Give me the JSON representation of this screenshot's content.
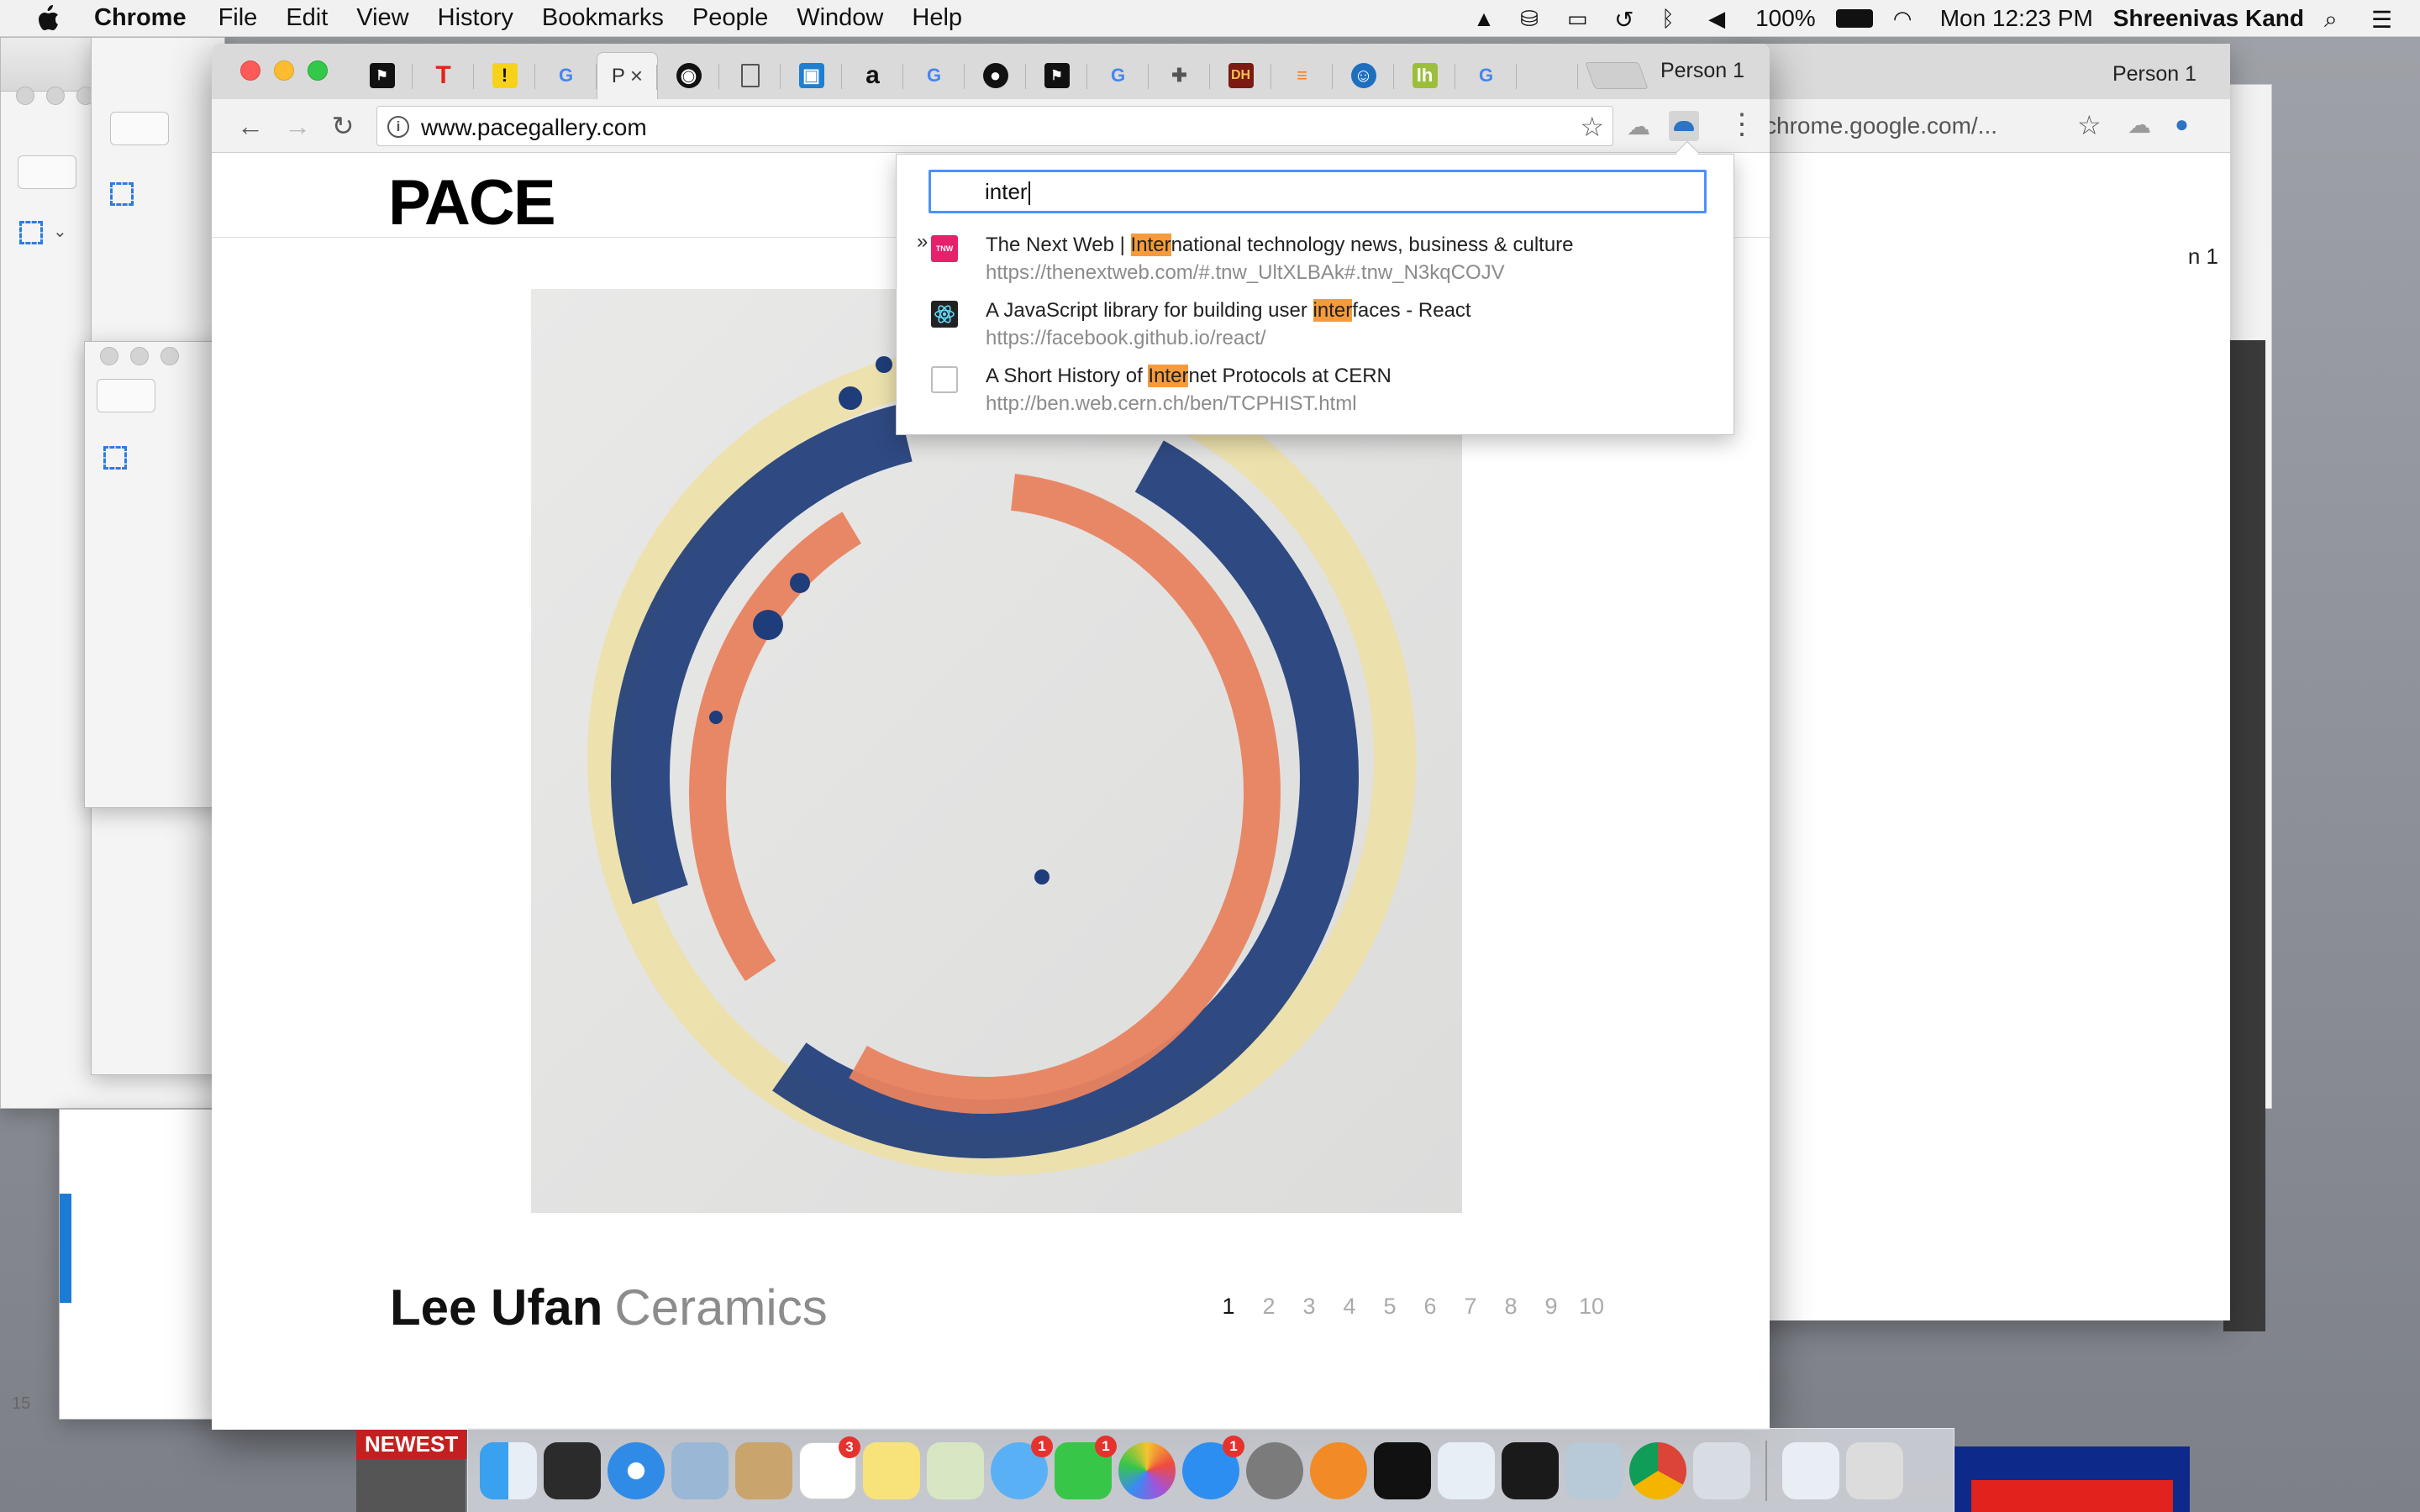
{
  "menubar": {
    "app_name": "Chrome",
    "items": [
      "File",
      "Edit",
      "View",
      "History",
      "Bookmarks",
      "People",
      "Window",
      "Help"
    ],
    "battery": "100%",
    "clock": "Mon 12:23 PM",
    "user": "Shreenivas Kand"
  },
  "browser": {
    "active_tab_title": "P",
    "profile": "Person 1",
    "url": "www.pacegallery.com",
    "tab_icons": [
      "flag-icon",
      "t-icon",
      "yellow-icon",
      "google-icon",
      "pace-tab",
      "circle-icon",
      "doc-icon",
      "photo-icon",
      "amazon-icon",
      "google-icon",
      "github-icon",
      "flag-icon",
      "google-icon",
      "puzzle-icon",
      "dh-icon",
      "stack-icon",
      "pbs-icon",
      "lh-icon",
      "google-icon",
      "apple-icon"
    ]
  },
  "page": {
    "logo": "PACE",
    "artist": "Lee Ufan",
    "exhibition": "Ceramics",
    "pages": [
      "1",
      "2",
      "3",
      "4",
      "5",
      "6",
      "7",
      "8",
      "9",
      "10"
    ],
    "current_page": "1"
  },
  "popup": {
    "query": "inter",
    "results": [
      {
        "marker": "»",
        "title_pre": "The Next Web | ",
        "title_hl": "Inter",
        "title_post": "national technology news, business & culture",
        "url": "https://thenextweb.com/#.tnw_UltXLBAk#.tnw_N3kqCOJV",
        "fav_text": "TNW"
      },
      {
        "marker": "",
        "title_pre": "A JavaScript library for building user ",
        "title_hl": "inter",
        "title_post": "faces - React",
        "url": "https://facebook.github.io/react/",
        "fav_text": ""
      },
      {
        "marker": "",
        "title_pre": "A Short History of ",
        "title_hl": "Inter",
        "title_post": "net Protocols at CERN",
        "url": "http://ben.web.cern.ch/ben/TCPHIST.html",
        "fav_text": ""
      }
    ]
  },
  "right_window": {
    "profile": "Person 1",
    "url": "chrome.google.com/...",
    "partial_tab": "n 1"
  },
  "dock": {
    "newest_label": "NEWEST",
    "badges": {
      "reminders": "3",
      "messages": "1",
      "facetime": "1",
      "appstore": "1"
    }
  },
  "side_number": "15"
}
